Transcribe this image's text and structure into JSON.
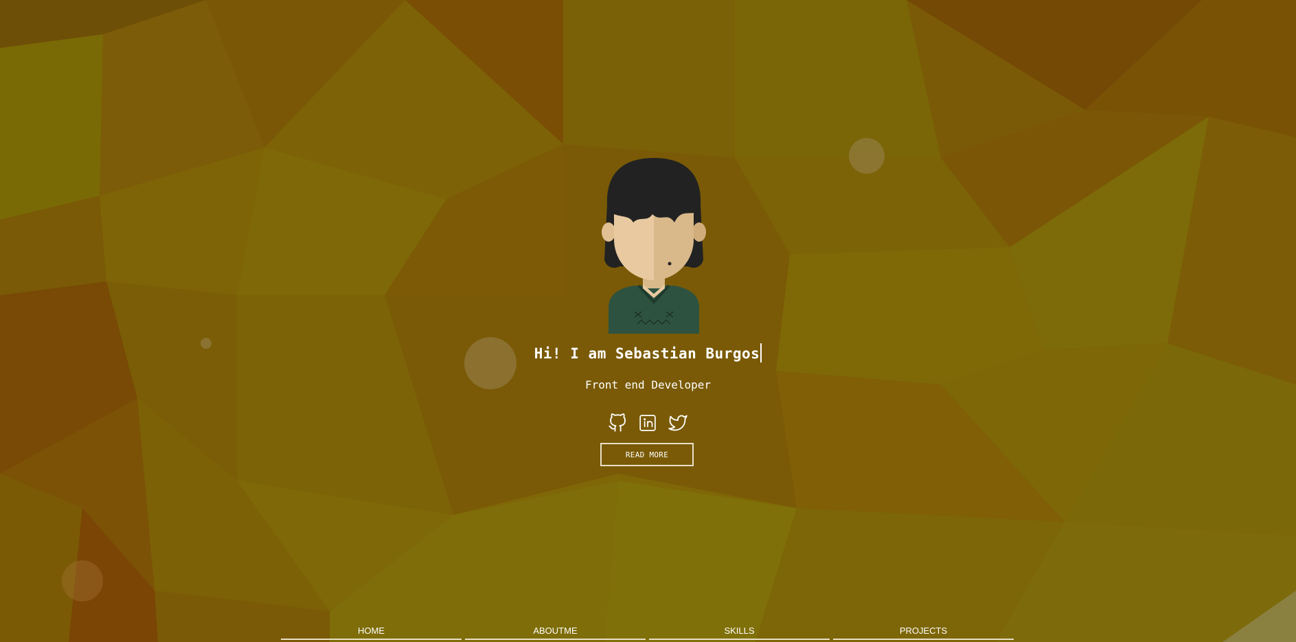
{
  "hero": {
    "greeting": "Hi! I am Sebastian Burgos",
    "role": "Front end Developer",
    "read_more_label": "READ MORE"
  },
  "socials": [
    {
      "icon": "github-icon"
    },
    {
      "icon": "linkedin-icon"
    },
    {
      "icon": "twitter-icon"
    }
  ],
  "nav": {
    "items": [
      {
        "label": "HOME"
      },
      {
        "label": "ABOUTME"
      },
      {
        "label": "SKILLS"
      },
      {
        "label": "PROJECTS"
      }
    ]
  },
  "colors": {
    "background_base": "#7a5a06",
    "text": "#ffffff",
    "button_border": "#e9e0c8",
    "avatar_hair": "#222222",
    "avatar_skin": "#e8c9a0",
    "avatar_sweater": "#2e5240"
  }
}
